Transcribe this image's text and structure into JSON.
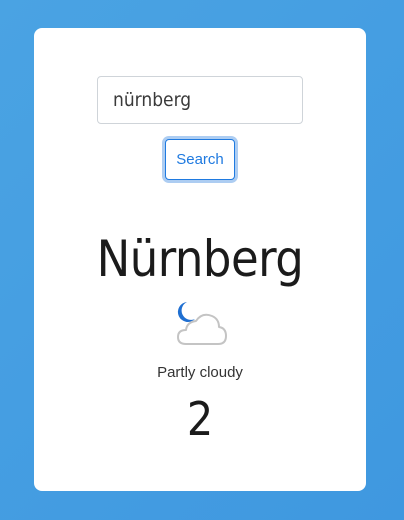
{
  "search": {
    "value": "nürnberg",
    "button_label": "Search"
  },
  "weather": {
    "city": "Nürnberg",
    "icon": "partly-cloudy-night-icon",
    "condition": "Partly cloudy",
    "temperature": "2"
  },
  "colors": {
    "background": "#4aa3e3",
    "card": "#ffffff",
    "accent": "#1f7ae0",
    "moon": "#1f6fd1",
    "cloud_outline": "#c4c4c4"
  }
}
